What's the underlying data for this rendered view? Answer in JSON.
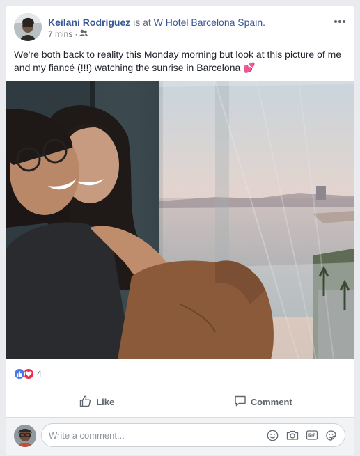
{
  "post": {
    "author": "Keilani Rodriguez",
    "verb": "is at",
    "place": "W Hotel Barcelona Spain.",
    "time": "7 mins",
    "separator": "·",
    "audience_icon": "friends-icon",
    "text": "We're both back to reality this Monday morning but look at this picture of me and my fiancé (!!!) watching the sunrise in Barcelona",
    "emoji": "💕"
  },
  "reactions": {
    "types": [
      "like",
      "love"
    ],
    "count": "4",
    "colors": {
      "like": "#4a76e8",
      "love": "#f0284a"
    }
  },
  "actions": {
    "like_label": "Like",
    "comment_label": "Comment"
  },
  "composer": {
    "placeholder": "Write a comment...",
    "icons": [
      "emoji-icon",
      "camera-icon",
      "gif-icon",
      "sticker-icon"
    ]
  },
  "colors": {
    "link": "#385898",
    "secondary_text": "#606770",
    "background": "#e9ebee"
  }
}
